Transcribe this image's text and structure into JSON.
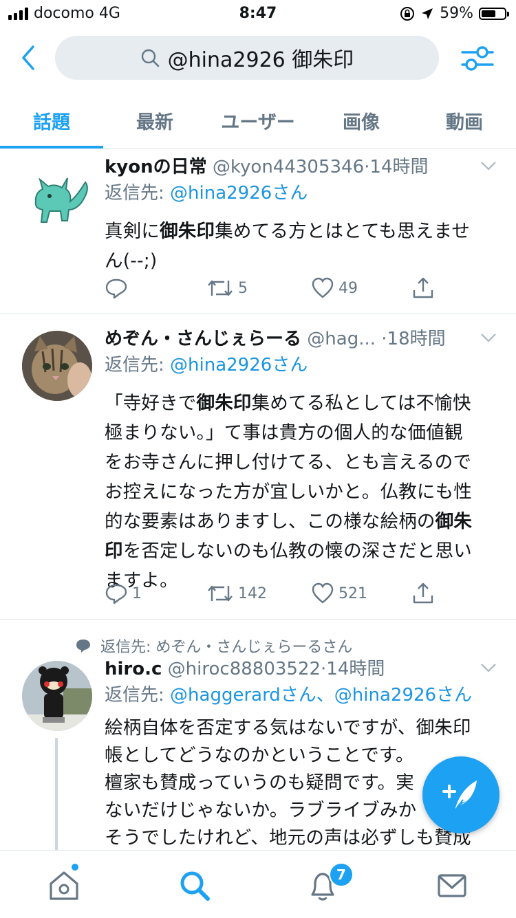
{
  "status_bar": {
    "carrier": "docomo",
    "network": "4G",
    "time": "8:47",
    "battery": "59%"
  },
  "search": {
    "query": "@hina2926 御朱印"
  },
  "tabs": [
    {
      "label": "話題",
      "active": true
    },
    {
      "label": "最新"
    },
    {
      "label": "ユーザー"
    },
    {
      "label": "画像"
    },
    {
      "label": "動画"
    }
  ],
  "tweets": [
    {
      "name": "kyonの日常",
      "handle": "@kyon44305346",
      "time": "·14時間",
      "reply_prefix": "返信先: ",
      "reply_to": "@hina2926さん",
      "body_parts": [
        "真剣に",
        "御朱印",
        "集めてる方とはとても思えませ",
        "ん(--;)"
      ],
      "replies": "",
      "retweets": "5",
      "likes": "49"
    },
    {
      "name": "めぞん・さんじぇらーる",
      "handle": "@hag...",
      "time": "·18時間",
      "reply_prefix": "返信先: ",
      "reply_to": "@hina2926さん",
      "body_parts": [
        "「寺好きで",
        "御朱印",
        "集めてる私としては不愉快",
        "極まりない。」て事は貴方の個人的な価値観",
        "をお寺さんに押し付けてる、とも言えるので",
        "お控えになった方が宜しいかと。仏教にも性",
        "的な要素はありますし、この様な絵柄の",
        "御朱",
        "印",
        "を否定しないのも仏教の懐の深さだと思い",
        "ますよ。"
      ],
      "replies": "1",
      "retweets": "142",
      "likes": "521"
    },
    {
      "context": "返信先: めぞん・さんじぇらーるさん",
      "name": "hiro.c",
      "handle": "@hiroc88803522",
      "time": "·14時間",
      "reply_prefix": "返信先: ",
      "reply_to": "@haggerardさん、@hina2926さん",
      "body_lines": [
        "絵柄自体を否定する気はないですが、御朱印",
        "帳としてどうなのかということです。",
        "檀家も賛成っていうのも疑問です。実",
        "ないだけじゃないか。ラブライブみか",
        "そうでしたけれど、地元の声は必ずしも賛成"
      ]
    }
  ],
  "bottom_nav": {
    "notifications_badge": "7"
  }
}
